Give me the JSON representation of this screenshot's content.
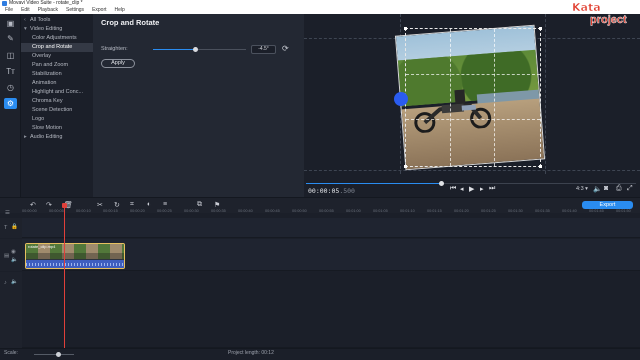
{
  "window": {
    "title": "Movavi Video Suite - rotate_clip *"
  },
  "menu": [
    "File",
    "Edit",
    "Playback",
    "Settings",
    "Export",
    "Help"
  ],
  "tools_list": {
    "items": [
      {
        "label": "All Tools",
        "level": "top",
        "caret": ""
      },
      {
        "label": "Video Editing",
        "level": "top",
        "caret": "▾"
      },
      {
        "label": "Color Adjustments",
        "level": "sub",
        "caret": ""
      },
      {
        "label": "Crop and Rotate",
        "level": "sub",
        "caret": "",
        "active": true
      },
      {
        "label": "Overlay",
        "level": "sub",
        "caret": ""
      },
      {
        "label": "Pan and Zoom",
        "level": "sub",
        "caret": ""
      },
      {
        "label": "Stabilization",
        "level": "sub",
        "caret": ""
      },
      {
        "label": "Animation",
        "level": "sub",
        "caret": ""
      },
      {
        "label": "Highlight and Conc...",
        "level": "sub",
        "caret": ""
      },
      {
        "label": "Chroma Key",
        "level": "sub",
        "caret": ""
      },
      {
        "label": "Scene Detection",
        "level": "sub",
        "caret": ""
      },
      {
        "label": "Logo",
        "level": "sub",
        "caret": ""
      },
      {
        "label": "Slow Motion",
        "level": "sub",
        "caret": ""
      },
      {
        "label": "Audio Editing",
        "level": "top",
        "caret": "▸"
      }
    ]
  },
  "properties": {
    "heading": "Crop and Rotate",
    "straighten_label": "Straighten:",
    "straighten_value": "-4.5°",
    "straighten_fraction": 0.45,
    "apply_label": "Apply"
  },
  "player": {
    "timecode": "00:00:05",
    "timecode_frames": ".500",
    "progress_fraction": 0.41,
    "aspect_label": "4:3 ▾"
  },
  "timeline": {
    "export_label": "Export",
    "ruler_labels": [
      "00:00:00",
      "00:00:05",
      "00:00:10",
      "00:00:15",
      "00:00:20",
      "00:00:25",
      "00:00:30",
      "00:00:35",
      "00:00:40",
      "00:00:45",
      "00:00:50",
      "00:00:55",
      "00:01:00",
      "00:01:05",
      "00:01:10",
      "00:01:15",
      "00:01:20",
      "00:01:25",
      "00:01:30",
      "00:01:35",
      "00:01:40",
      "00:01:45",
      "00:01:50"
    ],
    "clip_title": "rotate_clip.mp4"
  },
  "status": {
    "scale_label": "Scale:",
    "project_length": "Project length:  00:12"
  },
  "watermark": {
    "line1": "Kata",
    "line2": "project"
  },
  "colors": {
    "accent": "#2a8cf0",
    "playhead": "#e0403a",
    "clip_border": "#e6c060",
    "watermark": "#e03a2b"
  }
}
